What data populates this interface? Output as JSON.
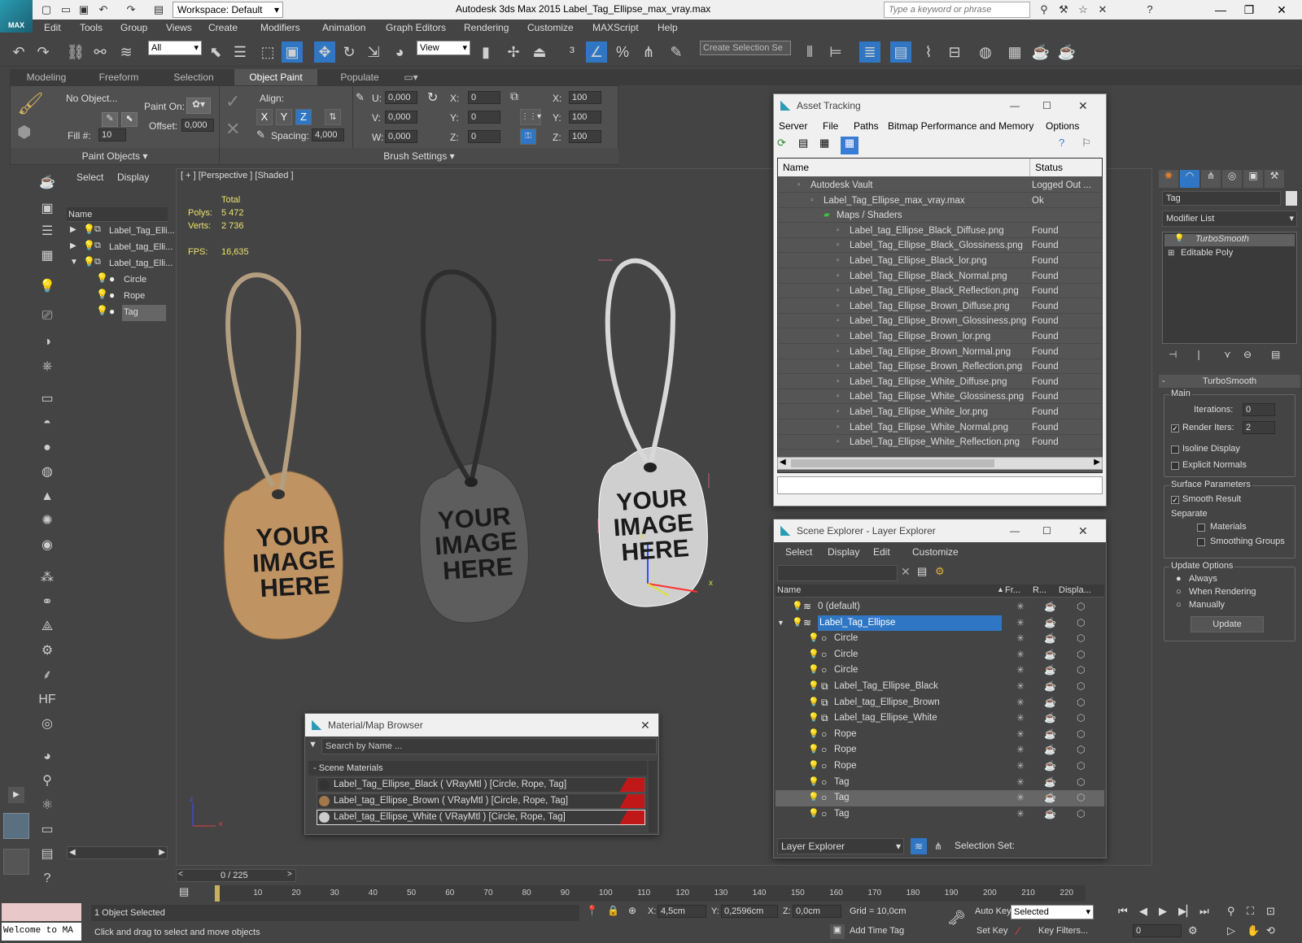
{
  "app": {
    "logo": "MAX",
    "workspace": "Workspace: Default",
    "title": "Autodesk 3ds Max  2015     Label_Tag_Ellipse_max_vray.max",
    "search_placeholder": "Type a keyword or phrase"
  },
  "menu": [
    "Edit",
    "Tools",
    "Group",
    "Views",
    "Create",
    "Modifiers",
    "Animation",
    "Graph Editors",
    "Rendering",
    "Customize",
    "MAXScript",
    "Help"
  ],
  "toolbar": {
    "filter": "All",
    "view": "View",
    "selection_set": "Create Selection Se"
  },
  "ribbon": {
    "tabs": [
      "Modeling",
      "Freeform",
      "Selection",
      "Object Paint",
      "Populate"
    ],
    "active": "Object Paint",
    "no_object": "No Object...",
    "paint_on": "Paint On:",
    "fill_label": "Fill #:",
    "fill": "10",
    "offset_label": "Offset:",
    "offset": "0,000",
    "align": "Align:",
    "spacing_label": "Spacing:",
    "spacing": "4,000",
    "paint_objects": "Paint Objects",
    "brush_settings": "Brush Settings",
    "u_label": "U:",
    "v_label": "V:",
    "w_label": "W:",
    "u": "0,000",
    "v": "0,000",
    "w": "0,000",
    "x_label": "X:",
    "y_label": "Y:",
    "z_label": "Z:",
    "rx": "0",
    "ry": "0",
    "rz": "0",
    "sx": "100",
    "sy": "100",
    "sz": "100",
    "axis_x": "X",
    "axis_y": "Y",
    "axis_z": "Z"
  },
  "scene_explorer_left": {
    "tabs": [
      "Select",
      "Display"
    ],
    "col": "Name",
    "items": [
      "Label_Tag_Elli...",
      "Label_tag_Elli...",
      "Label_tag_Elli...",
      "Circle",
      "Rope",
      "Tag"
    ]
  },
  "viewport": {
    "label": "[ + ] [Perspective ] [Shaded ]",
    "total": "Total",
    "polys_label": "Polys:",
    "polys": "5 472",
    "verts_label": "Verts:",
    "verts": "2 736",
    "fps_label": "FPS:",
    "fps": "16,635",
    "tag_text": [
      "YOUR",
      "IMAGE",
      "HERE"
    ],
    "axis_x": "x",
    "axis_y": "y",
    "axis_z": "z"
  },
  "asset_tracking": {
    "title": "Asset Tracking",
    "menu": [
      "Server",
      "File",
      "Paths",
      "Bitmap Performance and Memory",
      "Options"
    ],
    "col_name": "Name",
    "col_status": "Status",
    "rows": [
      {
        "name": "Autodesk Vault",
        "status": "Logged Out ...",
        "indent": 1
      },
      {
        "name": "Label_Tag_Ellipse_max_vray.max",
        "status": "Ok",
        "indent": 2
      },
      {
        "name": "Maps / Shaders",
        "status": "",
        "indent": 3
      },
      {
        "name": "Label_tag_Ellipse_Black_Diffuse.png",
        "status": "Found",
        "indent": 4
      },
      {
        "name": "Label_Tag_Ellipse_Black_Glossiness.png",
        "status": "Found",
        "indent": 4
      },
      {
        "name": "Label_Tag_Ellipse_Black_lor.png",
        "status": "Found",
        "indent": 4
      },
      {
        "name": "Label_Tag_Ellipse_Black_Normal.png",
        "status": "Found",
        "indent": 4
      },
      {
        "name": "Label_Tag_Ellipse_Black_Reflection.png",
        "status": "Found",
        "indent": 4
      },
      {
        "name": "Label_Tag_Ellipse_Brown_Diffuse.png",
        "status": "Found",
        "indent": 4
      },
      {
        "name": "Label_Tag_Ellipse_Brown_Glossiness.png",
        "status": "Found",
        "indent": 4
      },
      {
        "name": "Label_Tag_Ellipse_Brown_lor.png",
        "status": "Found",
        "indent": 4
      },
      {
        "name": "Label_Tag_Ellipse_Brown_Normal.png",
        "status": "Found",
        "indent": 4
      },
      {
        "name": "Label_Tag_Ellipse_Brown_Reflection.png",
        "status": "Found",
        "indent": 4
      },
      {
        "name": "Label_Tag_Ellipse_White_Diffuse.png",
        "status": "Found",
        "indent": 4
      },
      {
        "name": "Label_Tag_Ellipse_White_Glossiness.png",
        "status": "Found",
        "indent": 4
      },
      {
        "name": "Label_Tag_Ellipse_White_lor.png",
        "status": "Found",
        "indent": 4
      },
      {
        "name": "Label_Tag_Ellipse_White_Normal.png",
        "status": "Found",
        "indent": 4
      },
      {
        "name": "Label_Tag_Ellipse_White_Reflection.png",
        "status": "Found",
        "indent": 4
      }
    ]
  },
  "layer_explorer": {
    "title": "Scene Explorer - Layer Explorer",
    "menu": [
      "Select",
      "Display",
      "Edit",
      "Customize"
    ],
    "cols": [
      "Name",
      "Fr...",
      "R...",
      "Displa..."
    ],
    "rows": [
      {
        "name": "0 (default)",
        "indent": 0,
        "type": "layer"
      },
      {
        "name": "Label_Tag_Ellipse",
        "indent": 0,
        "type": "layer",
        "selected": true
      },
      {
        "name": "Circle",
        "indent": 1,
        "type": "obj"
      },
      {
        "name": "Circle",
        "indent": 1,
        "type": "obj"
      },
      {
        "name": "Circle",
        "indent": 1,
        "type": "obj"
      },
      {
        "name": "Label_Tag_Ellipse_Black",
        "indent": 1,
        "type": "grp"
      },
      {
        "name": "Label_tag_Ellipse_Brown",
        "indent": 1,
        "type": "grp"
      },
      {
        "name": "Label_tag_Ellipse_White",
        "indent": 1,
        "type": "grp"
      },
      {
        "name": "Rope",
        "indent": 1,
        "type": "obj"
      },
      {
        "name": "Rope",
        "indent": 1,
        "type": "obj"
      },
      {
        "name": "Rope",
        "indent": 1,
        "type": "obj"
      },
      {
        "name": "Tag",
        "indent": 1,
        "type": "obj"
      },
      {
        "name": "Tag",
        "indent": 1,
        "type": "obj",
        "hl": true
      },
      {
        "name": "Tag",
        "indent": 1,
        "type": "obj"
      }
    ],
    "footer": "Layer Explorer",
    "selection_set": "Selection Set:"
  },
  "material_browser": {
    "title": "Material/Map Browser",
    "search": "Search by Name ...",
    "group": "- Scene Materials",
    "items": [
      {
        "name": "Label_Tag_Ellipse_Black  ( VRayMtl )  [Circle, Rope, Tag]",
        "color": "#333333"
      },
      {
        "name": "Label_tag_Ellipse_Brown  ( VRayMtl )  [Circle, Rope, Tag]",
        "color": "#a0784a"
      },
      {
        "name": "Label_tag_Ellipse_White  ( VRayMtl )  [Circle, Rope, Tag]",
        "color": "#cccccc"
      }
    ]
  },
  "command_panel": {
    "name": "Tag",
    "modifier_list": "Modifier List",
    "stack": [
      "TurboSmooth",
      "Editable Poly"
    ],
    "rollout": "TurboSmooth",
    "main": "Main",
    "iterations_label": "Iterations:",
    "iterations": "0",
    "render_iters_label": "Render Iters:",
    "render_iters": "2",
    "isoline": "Isoline Display",
    "explicit": "Explicit Normals",
    "surface": "Surface Parameters",
    "smooth_result": "Smooth Result",
    "separate": "Separate",
    "materials": "Materials",
    "smoothing": "Smoothing Groups",
    "update_options": "Update Options",
    "always": "Always",
    "when_rendering": "When Rendering",
    "manually": "Manually",
    "update": "Update"
  },
  "timeline": {
    "frame": "0 / 225",
    "ticks": [
      "0",
      "10",
      "20",
      "30",
      "40",
      "50",
      "60",
      "70",
      "80",
      "90",
      "100",
      "110",
      "120",
      "130",
      "140",
      "150",
      "160",
      "170",
      "180",
      "190",
      "200",
      "210",
      "220"
    ]
  },
  "status": {
    "maxscript": "Welcome to MA",
    "selected": "1 Object Selected",
    "hint": "Click and drag to select and move objects",
    "x_label": "X:",
    "x": "4,5cm",
    "y_label": "Y:",
    "y": "0,2596cm",
    "z_label": "Z:",
    "z": "0,0cm",
    "grid": "Grid = 10,0cm",
    "autokey": "Auto Key",
    "setkey": "Set Key",
    "selected_combo": "Selected",
    "keyfilters": "Key Filters...",
    "add_time_tag": "Add Time Tag",
    "frame": "0"
  }
}
